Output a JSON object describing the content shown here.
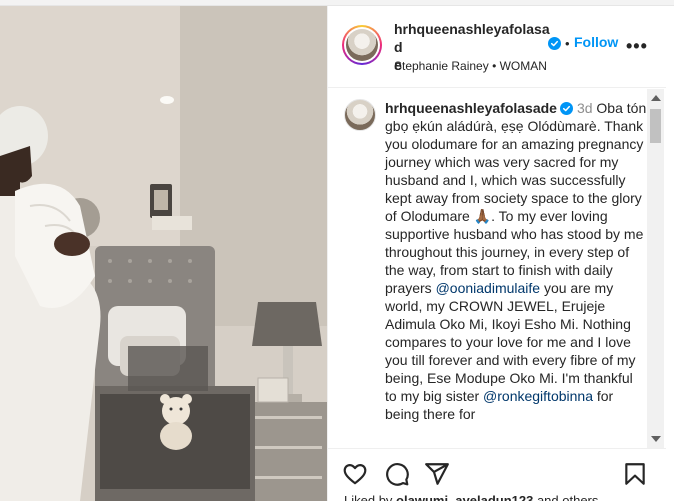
{
  "post": {
    "username_line1": "hrhqueenashleyafolasad",
    "username_line2": "e",
    "follow_label": "Follow",
    "separator": "•",
    "more_label": "•••",
    "subline": "Stephanie Rainey • WOMAN"
  },
  "caption": {
    "username": "hrhqueenashleyafolasade",
    "time": "3d",
    "text_1": "Oba tón gbọ ẹkún aládúrà, ẹṣẹ Olódùmarè. Thank you olodumare for an amazing pregnancy journey which was very sacred for my husband and I, which was successfully kept away from society space to the glory of Olodumare ",
    "emoji": "🙏🏾",
    "text_2": ". To my ever loving supportive husband who has stood by me throughout this journey, in every step of the way, from start to finish with daily prayers ",
    "mention_1": "@ooniadimulaife",
    "text_3": " you are my world, my CROWN JEWEL, Erujeje Adimula Oko Mi, Ikoyi Esho Mi. Nothing compares to your love for me and I love you till forever and with every fibre of my being, Ese Modupe Oko Mi. I'm thankful to my big sister ",
    "mention_2": "@ronkegiftobinna",
    "text_4": " for being there for"
  },
  "liked_by": {
    "prefix": "Liked by ",
    "names": "olawumi_ayeladun123",
    "suffix": " and others"
  },
  "icons": {
    "heart": "heart-icon",
    "comment": "comment-icon",
    "share": "share-icon",
    "save": "bookmark-icon",
    "verified": "verified-badge-icon"
  },
  "colors": {
    "link": "#0095f6",
    "mention": "#00376b",
    "muted": "#8e8e8e",
    "text": "#262626"
  }
}
